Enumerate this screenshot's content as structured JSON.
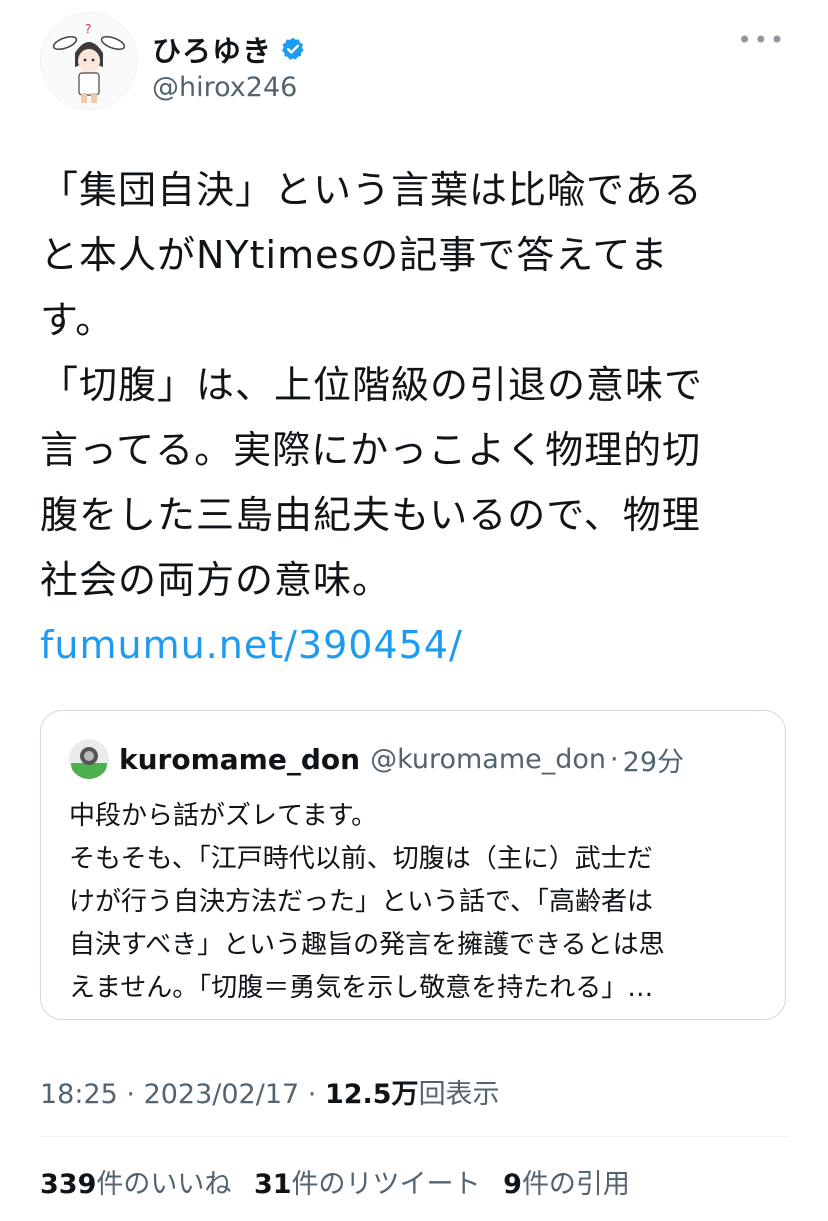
{
  "author": {
    "display_name": "ひろゆき",
    "handle": "@hirox246",
    "verified": true,
    "avatar_icon": "user-avatar-illustration"
  },
  "more_label": "•••",
  "tweet": {
    "lines": [
      "「集団自決」という言葉は比喩である",
      "と本人がNYtimesの記事で答えてま",
      "す。",
      "「切腹」は、上位階級の引退の意味で",
      "言ってる。実際にかっこよく物理的切",
      "腹をした三島由紀夫もいるので、物理",
      "社会の両方の意味。"
    ],
    "link": "fumumu.net/390454/"
  },
  "quote": {
    "name": "kuromame_don",
    "handle": "@kuromame_don",
    "separator": "·",
    "time": "29分",
    "lines": [
      "中段から話がズレてます。",
      "そもそも、「江戸時代以前、切腹は（主に）武士だ",
      "けが行う自決方法だった」という話で、「高齢者は",
      "自決すべき」という趣旨の発言を擁護できるとは思",
      "えません。「切腹＝勇気を示し敬意を持たれる」…"
    ]
  },
  "meta": {
    "time": "18:25",
    "sep": " · ",
    "date": "2023/02/17",
    "views_num": "12.5万",
    "views_label": "回表示"
  },
  "stats": {
    "likes_num": "339",
    "likes_label": "件のいいね",
    "retweets_num": "31",
    "retweets_label": "件のリツイート",
    "quotes_num": "9",
    "quotes_label": "件の引用"
  },
  "colors": {
    "link": "#1d9bf0",
    "secondary_text": "#536471",
    "border": "#cfd9de"
  }
}
